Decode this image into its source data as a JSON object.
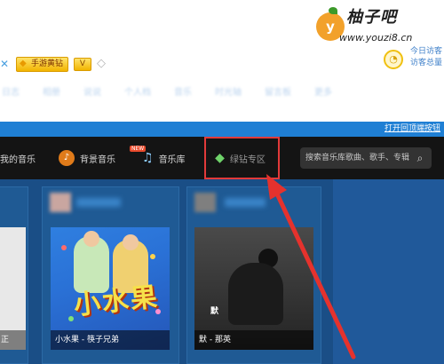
{
  "badges": {
    "x_glyph": "✕",
    "gold_label": "手游黄钻",
    "gold_icon": "diamond-icon",
    "v_label": "V",
    "gray_icon": "diamond-outline-icon"
  },
  "watermark": {
    "logo_letter": "y",
    "title": "柚子吧",
    "url": "www.youzi8.cn"
  },
  "side_stats": {
    "line1": "今日访客",
    "line2": "访客总量"
  },
  "blurred_nav": [
    "日志",
    "相册",
    "说说",
    "个人档",
    "音乐",
    "时光轴",
    "留言板",
    "更多"
  ],
  "blue_bar": {
    "link": "打开回顶端按钮"
  },
  "nav": {
    "items": [
      {
        "label": "我的音乐",
        "icon": "music-home-icon"
      },
      {
        "label": "背景音乐",
        "icon": "background-music-icon",
        "badge": "NEW"
      },
      {
        "label": "音乐库",
        "icon": "music-note-icon"
      },
      {
        "label": "绿钻专区",
        "icon": "green-diamond-icon",
        "highlighted": true
      }
    ],
    "search_placeholder": "搜索音乐库歌曲、歌手、专辑"
  },
  "cards": [
    {
      "caption": "正"
    },
    {
      "cover_title": "小水果",
      "caption": "小水果 - 筷子兄弟"
    },
    {
      "caption": "默 - 那英",
      "cover_mark": "默"
    }
  ],
  "colors": {
    "accent_blue": "#1f7fd4",
    "nav_dark": "#141414",
    "highlight_red": "#e23a3a",
    "content_blue": "#1a4e86",
    "watermark_orange": "#f2a12b"
  }
}
